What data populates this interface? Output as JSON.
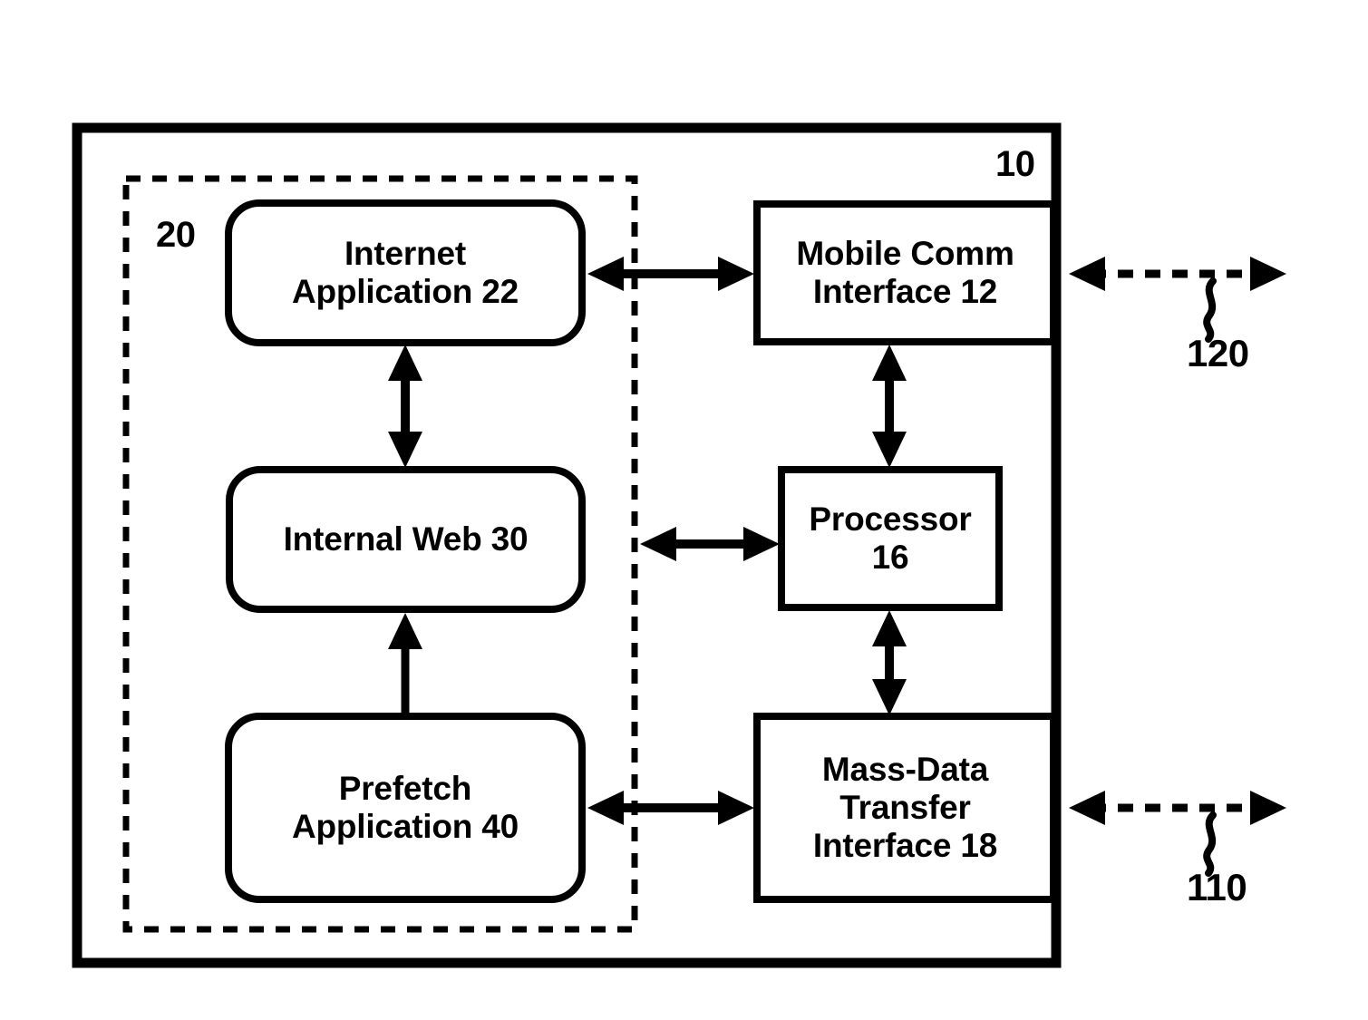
{
  "figure": {
    "kind": "patent-block-diagram",
    "background_color": "#ffffff",
    "stroke_color": "#000000",
    "outer_system": {
      "reference_numeral": "10",
      "shape": "rectangle"
    },
    "dashed_group": {
      "reference_numeral": "20",
      "shape": "dashed-rectangle"
    },
    "blocks": {
      "internet_application": {
        "label": "Internet\nApplication 22",
        "line1": "Internet",
        "line2": "Application 22",
        "shape": "rounded-rectangle"
      },
      "internal_web": {
        "label": "Internal Web 30",
        "line1": "Internal Web 30",
        "shape": "rounded-rectangle"
      },
      "prefetch_application": {
        "label": "Prefetch\nApplication 40",
        "line1": "Prefetch",
        "line2": "Application 40",
        "shape": "rounded-rectangle"
      },
      "mobile_comm_interface": {
        "label": "Mobile Comm\nInterface 12",
        "line1": "Mobile Comm",
        "line2": "Interface 12",
        "shape": "rectangle"
      },
      "processor": {
        "label": "Processor\n16",
        "line1": "Processor",
        "line2": "16",
        "shape": "rectangle"
      },
      "mass_data_transfer_interface": {
        "label": "Mass-Data\nTransfer\nInterface 18",
        "line1": "Mass-Data",
        "line2": "Transfer",
        "line3": "Interface 18",
        "shape": "rectangle"
      }
    },
    "external_links": {
      "mobile_link": {
        "reference_numeral": "120",
        "style": "dashed double-headed arrow"
      },
      "mass_data_link": {
        "reference_numeral": "110",
        "style": "dashed double-headed arrow"
      }
    },
    "connectors": [
      {
        "name": "internet-app-to-mobile-comm",
        "from": "internet_application",
        "to": "mobile_comm_interface",
        "heads": "double",
        "style": "solid",
        "orientation": "horizontal"
      },
      {
        "name": "internet-app-to-internal-web",
        "from": "internet_application",
        "to": "internal_web",
        "heads": "double",
        "style": "solid",
        "orientation": "vertical"
      },
      {
        "name": "internal-web-to-processor",
        "from": "internal_web",
        "to": "processor",
        "heads": "double",
        "style": "solid",
        "orientation": "horizontal"
      },
      {
        "name": "prefetch-app-to-internal-web",
        "from": "prefetch_application",
        "to": "internal_web",
        "heads": "single",
        "style": "solid",
        "orientation": "vertical"
      },
      {
        "name": "prefetch-app-to-mass-data",
        "from": "prefetch_application",
        "to": "mass_data_transfer_interface",
        "heads": "double",
        "style": "solid",
        "orientation": "horizontal"
      },
      {
        "name": "mobile-comm-to-processor",
        "from": "mobile_comm_interface",
        "to": "processor",
        "heads": "double",
        "style": "solid",
        "orientation": "vertical"
      },
      {
        "name": "processor-to-mass-data",
        "from": "processor",
        "to": "mass_data_transfer_interface",
        "heads": "double",
        "style": "solid",
        "orientation": "vertical"
      },
      {
        "name": "mobile-comm-external",
        "from": "mobile_comm_interface",
        "to": "mobile_link",
        "heads": "double",
        "style": "dashed",
        "orientation": "horizontal"
      },
      {
        "name": "mass-data-external",
        "from": "mass_data_transfer_interface",
        "to": "mass_data_link",
        "heads": "double",
        "style": "dashed",
        "orientation": "horizontal"
      }
    ]
  }
}
